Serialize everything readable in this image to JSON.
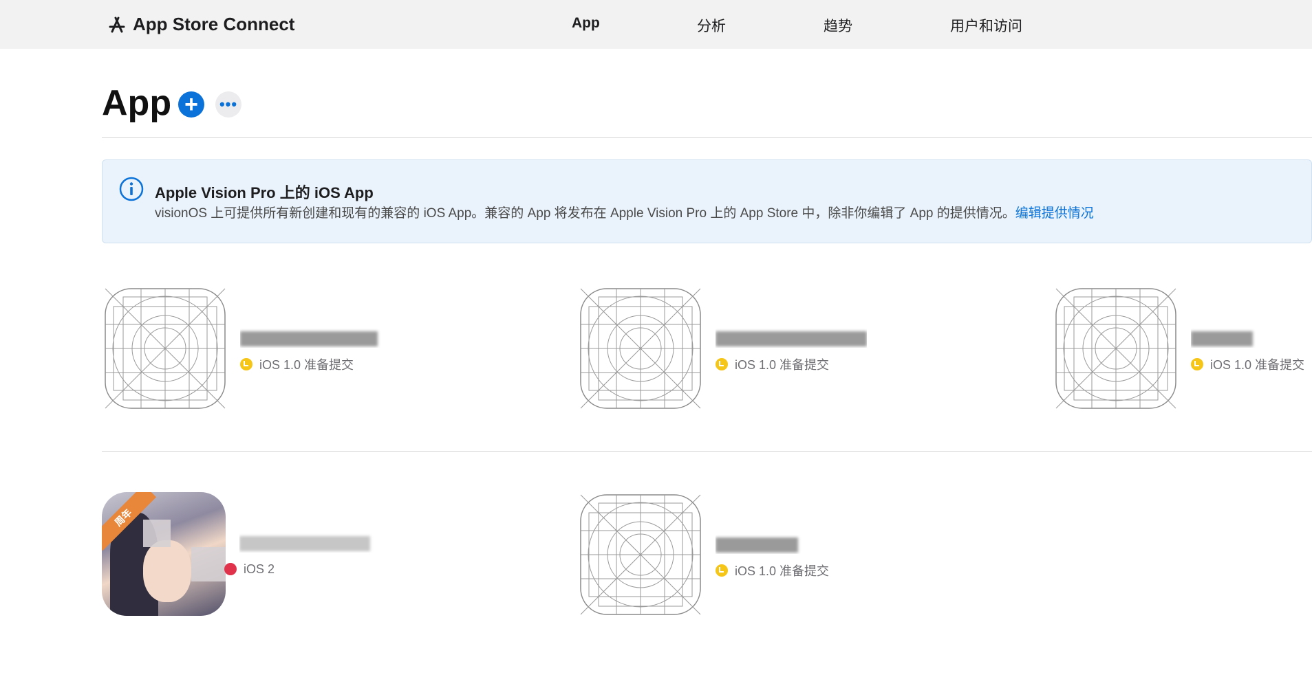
{
  "brand": {
    "title": "App Store Connect"
  },
  "nav": {
    "app": "App",
    "analytics": "分析",
    "trends": "趋势",
    "users": "用户和访问"
  },
  "page": {
    "title": "App"
  },
  "banner": {
    "title": "Apple Vision Pro 上的 iOS App",
    "body": "visionOS 上可提供所有新创建和现有的兼容的 iOS App。兼容的 App 将发布在 Apple Vision Pro 上的 App Store 中，除非你编辑了 App 的提供情况。",
    "link": "编辑提供情况"
  },
  "apps": [
    {
      "status": "iOS 1.0 准备提交"
    },
    {
      "status": "iOS 1.0 准备提交"
    },
    {
      "status": "iOS 1.0 准备提交"
    },
    {
      "status": "iOS 2",
      "ribbon": "周年"
    },
    {
      "status": "iOS 1.0 准备提交"
    }
  ]
}
